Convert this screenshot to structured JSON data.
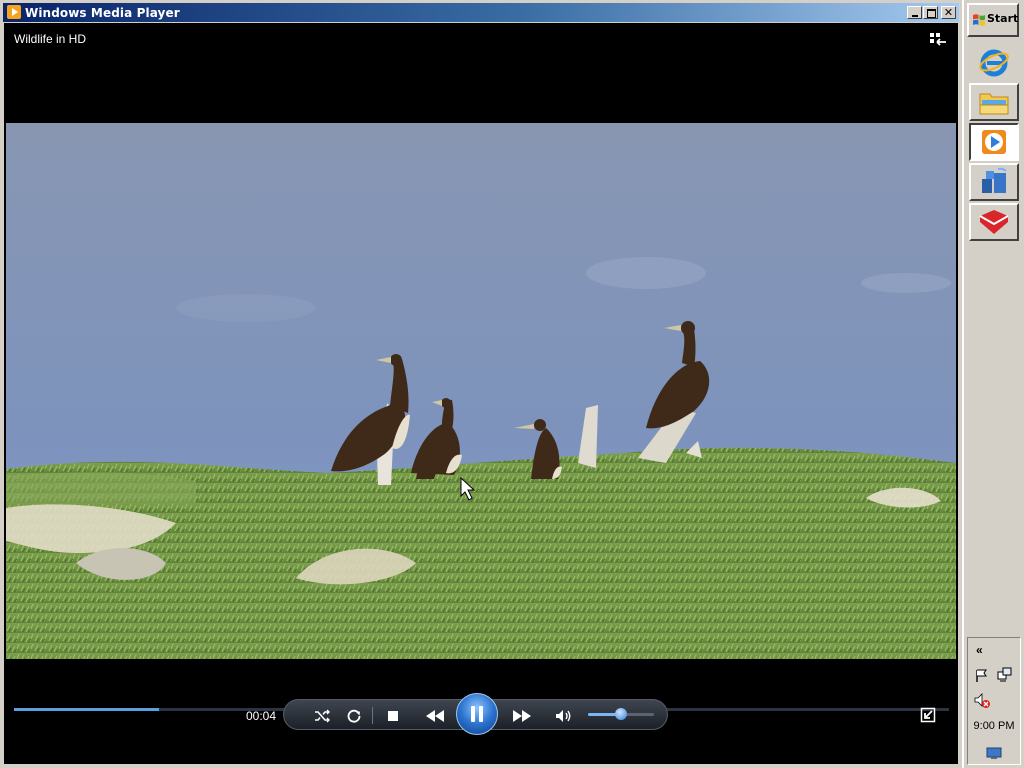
{
  "window": {
    "title": "Windows Media Player",
    "close_glyph": "✕"
  },
  "player": {
    "now_playing": "Wildlife in HD",
    "elapsed_time": "00:04",
    "seek_progress_fraction": 0.155,
    "volume_fraction": 0.5,
    "state": "playing"
  },
  "controls": [
    {
      "name": "shuffle-button",
      "icon": "shuffle-icon"
    },
    {
      "name": "repeat-button",
      "icon": "repeat-icon"
    },
    {
      "name": "stop-button",
      "icon": "stop-icon"
    },
    {
      "name": "previous-button",
      "icon": "rewind-icon"
    },
    {
      "name": "play-pause-button",
      "icon": "pause-icon"
    },
    {
      "name": "next-button",
      "icon": "fast-forward-icon"
    },
    {
      "name": "mute-button",
      "icon": "speaker-icon"
    }
  ],
  "taskbar": {
    "start_label": "Start",
    "items": [
      {
        "icon": "internet-explorer-icon"
      },
      {
        "icon": "file-explorer-icon"
      },
      {
        "icon": "windows-media-player-icon",
        "active": true
      },
      {
        "icon": "network-icon"
      },
      {
        "icon": "security-app-icon"
      }
    ],
    "tray_chevron": "«",
    "clock": "9:00 PM"
  },
  "colors": {
    "titlebar_start": "#0a246a",
    "titlebar_end": "#a6caf0",
    "seek_fill": "#5d9fe0",
    "player_bg": "#000000"
  }
}
